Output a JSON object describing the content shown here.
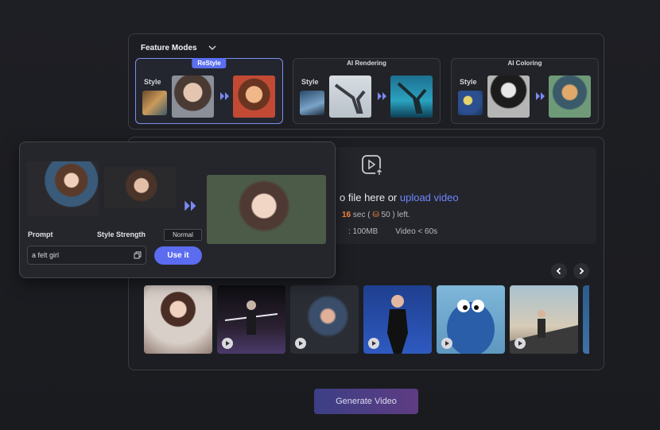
{
  "feature_modes": {
    "title": "Feature Modes",
    "style_label": "Style",
    "cards": [
      {
        "badge": "ReStyle",
        "active": true
      },
      {
        "badge": "AI Rendering",
        "active": false
      },
      {
        "badge": "AI Coloring",
        "active": false
      }
    ]
  },
  "upload": {
    "drop_text_prefix": "o file here or ",
    "drop_link": "upload video",
    "quota_seconds": "16",
    "quota_mid": " sec ( ",
    "quota_credits": "50",
    "quota_suffix": " ) left.",
    "size_limit": ": 100MB",
    "duration_limit": "Video < 60s"
  },
  "example": {
    "prompt_label": "Prompt",
    "strength_label": "Style Strength",
    "strength_value": "Normal",
    "prompt_value": "a felt girl",
    "use_it_label": "Use it"
  },
  "samples": [
    "ballet",
    "sword",
    "boxing",
    "posing",
    "cookie-monster",
    "ship"
  ],
  "generate_label": "Generate Video",
  "colors": {
    "accent": "#5b6cf0",
    "link": "#6e86ff",
    "highlight": "#ff8a3a"
  }
}
